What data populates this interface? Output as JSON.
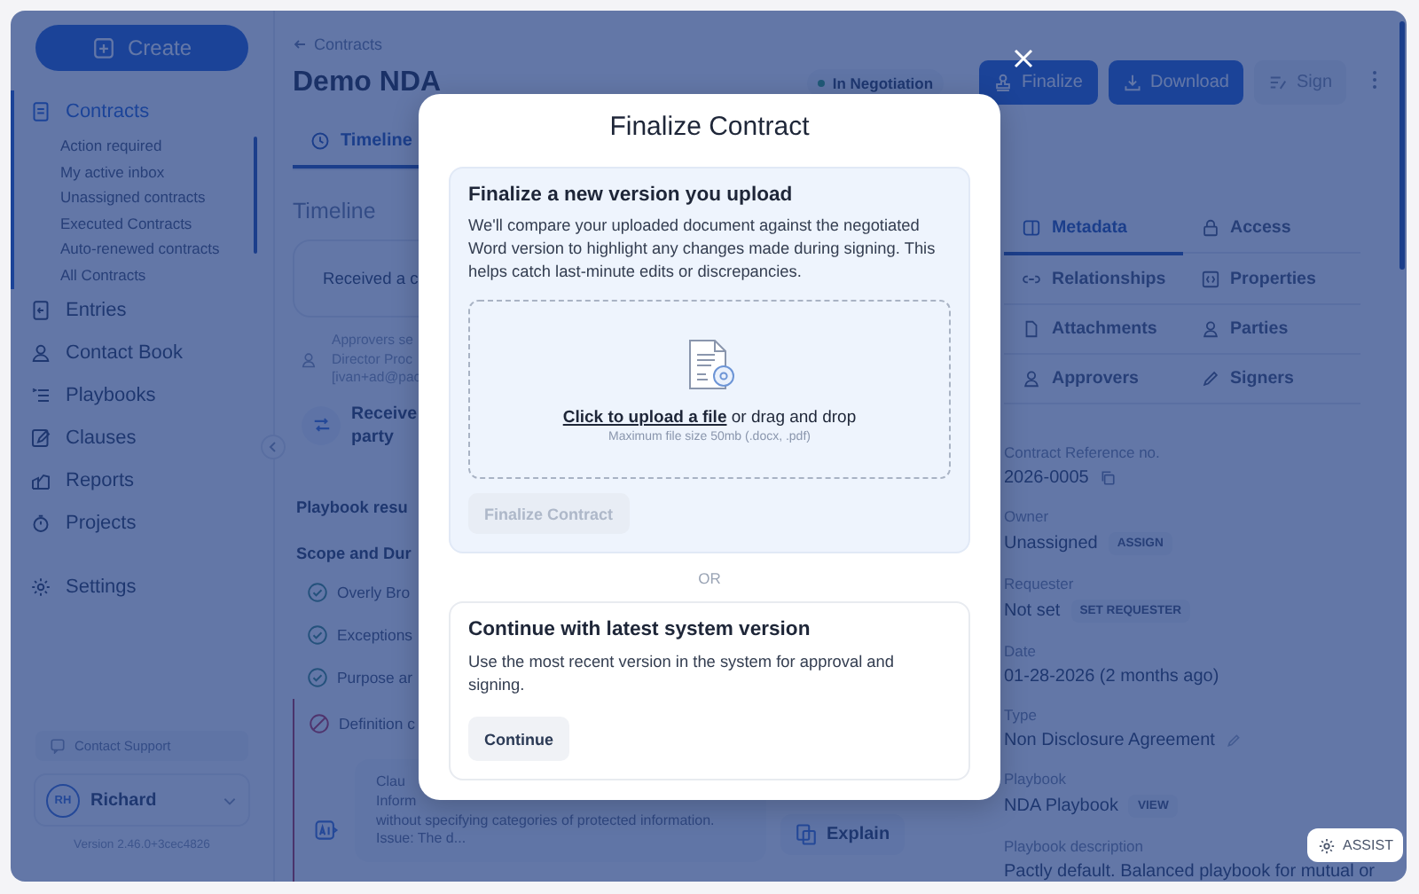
{
  "sidebar": {
    "create_label": "Create",
    "nav": [
      {
        "label": "Contracts",
        "selected": true,
        "children": [
          {
            "label": "Action required",
            "selected": false
          },
          {
            "label": "My active inbox",
            "selected": false
          },
          {
            "label": "Unassigned contracts",
            "selected": false
          },
          {
            "label": "Executed Contracts",
            "selected": false
          },
          {
            "label": "Auto-renewed contracts",
            "selected": false
          },
          {
            "label": "All Contracts",
            "selected": false
          }
        ]
      },
      {
        "label": "Entries",
        "selected": false
      },
      {
        "label": "Contact Book",
        "selected": false
      },
      {
        "label": "Playbooks",
        "selected": false
      },
      {
        "label": "Clauses",
        "selected": false
      },
      {
        "label": "Reports",
        "selected": false
      },
      {
        "label": "Projects",
        "selected": false
      },
      {
        "label": "Settings",
        "selected": false
      }
    ],
    "support": "Contact Support",
    "user": {
      "initials": "RH",
      "name": "Richard"
    },
    "version": "Version 2.46.0+3cec4826"
  },
  "header": {
    "breadcrumb": "Contracts",
    "title": "Demo NDA",
    "status": "In Negotiation",
    "actions": [
      {
        "label": "Finalize",
        "disabled": false
      },
      {
        "label": "Download",
        "disabled": false
      },
      {
        "label": "Sign",
        "disabled": true
      }
    ]
  },
  "tabs": [
    {
      "label": "Timeline",
      "selected": true
    }
  ],
  "timeline": {
    "heading": "Timeline",
    "event": "Received a c",
    "approvers": [
      "Approvers se",
      "Director Proc",
      "[ivan+ad@pac"
    ],
    "received": [
      "Receive",
      "party"
    ]
  },
  "playbook": {
    "heading": "Playbook resu",
    "group": "Scope and Dur",
    "items": [
      {
        "label": "Overly Bro",
        "passed": true
      },
      {
        "label": "Exceptions",
        "passed": true
      },
      {
        "label": "Purpose ar",
        "passed": true
      },
      {
        "label": "Definition c",
        "passed": false
      }
    ],
    "finding": {
      "lines": [
        "Clau",
        "Inform",
        "without specifying categories of protected information.",
        "Issue: The d..."
      ],
      "explain": "Explain"
    }
  },
  "panel": {
    "tabs": [
      {
        "label": "Metadata",
        "selected": true
      },
      {
        "label": "Access",
        "selected": false
      },
      {
        "label": "Relationships",
        "selected": false
      },
      {
        "label": "Properties",
        "selected": false
      },
      {
        "label": "Attachments",
        "selected": false
      },
      {
        "label": "Parties",
        "selected": false
      },
      {
        "label": "Approvers",
        "selected": false
      },
      {
        "label": "Signers",
        "selected": false
      }
    ],
    "fields": [
      {
        "label": "Contract Reference no.",
        "value": "2026-0005",
        "kind": "copy"
      },
      {
        "label": "Owner",
        "value": "Unassigned",
        "kind": "action",
        "action": "ASSIGN"
      },
      {
        "label": "Requester",
        "value": "Not set",
        "kind": "action",
        "action": "SET REQUESTER"
      },
      {
        "label": "Date",
        "value": "01-28-2026 (2 months ago)",
        "kind": "plain"
      },
      {
        "label": "Type",
        "value": "Non Disclosure Agreement",
        "kind": "edit"
      },
      {
        "label": "Playbook",
        "value": "NDA Playbook",
        "kind": "action",
        "action": "VIEW"
      },
      {
        "label": "Playbook description",
        "value": "Pactly default. Balanced playbook for mutual or",
        "kind": "plain"
      }
    ]
  },
  "assist_label": "ASSIST",
  "modal": {
    "title": "Finalize Contract",
    "upload": {
      "heading": "Finalize a new version you upload",
      "text": "We'll compare your uploaded document against the negotiated Word version to highlight any changes made during signing. This helps catch last-minute edits or discrepancies.",
      "link": "Click to upload a file",
      "prompt": "or drag and drop",
      "limits": "Maximum file size 50mb (.docx, .pdf)",
      "button": "Finalize Contract",
      "button_disabled": true
    },
    "separator": "OR",
    "latest": {
      "heading": "Continue with latest system version",
      "text": "Use the most recent version in the system for approval and signing.",
      "button": "Continue"
    }
  }
}
